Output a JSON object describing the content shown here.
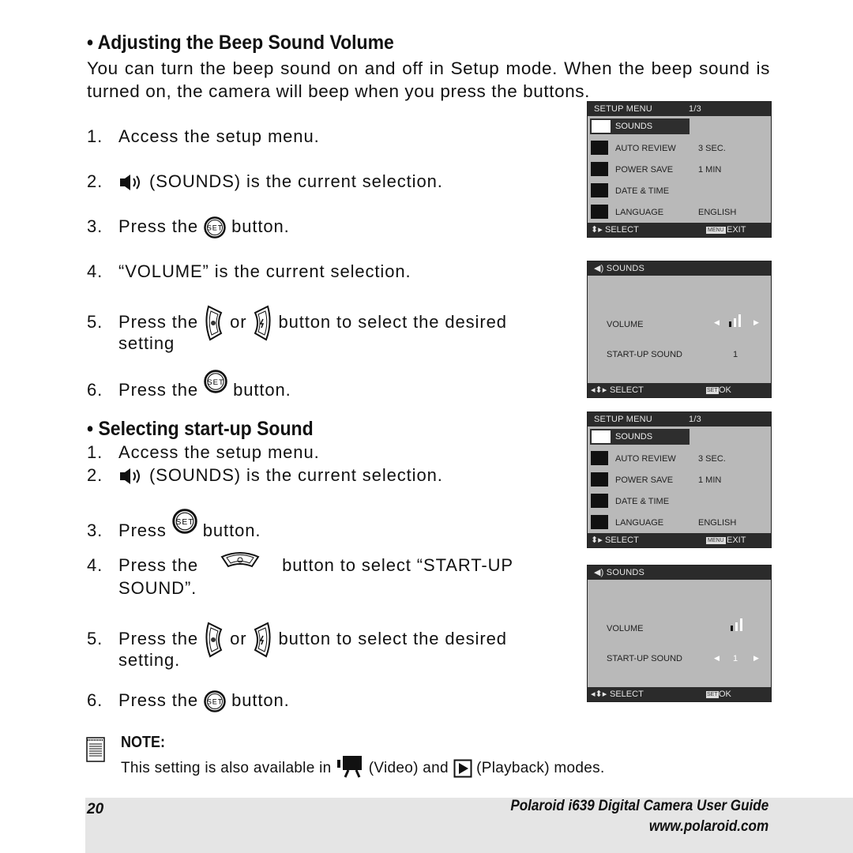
{
  "section1": {
    "heading": "• Adjusting the Beep Sound Volume",
    "intro": "You can turn the beep sound on and off in Setup mode. When the beep sound is turned on, the camera will beep when you press the buttons.",
    "steps": [
      {
        "num": "1.",
        "text": "Access the setup menu."
      },
      {
        "num": "2.",
        "icon": "speaker-icon",
        "text": "(SOUNDS) is the current selection."
      },
      {
        "num": "3.",
        "pre": "Press the",
        "icon": "set-button-icon",
        "post": "button."
      },
      {
        "num": "4.",
        "text": "“VOLUME” is the current selection."
      },
      {
        "num": "5.",
        "pre": "Press the",
        "mid": "or",
        "post": "button to select the desired",
        "cont": "setting"
      },
      {
        "num": "6.",
        "pre": "Press the",
        "icon": "set-button-icon",
        "post": "button."
      }
    ]
  },
  "section2": {
    "heading": "• Selecting start-up Sound",
    "steps": [
      {
        "num": "1.",
        "text": "Access the setup menu."
      },
      {
        "num": "2.",
        "icon": "speaker-icon",
        "text": "(SOUNDS) is the current selection."
      },
      {
        "num": "3.",
        "pre": "Press",
        "icon": "set-button-icon",
        "post": "button."
      },
      {
        "num": "4.",
        "pre": "Press the",
        "post": "button to select “START-UP",
        "cont": "SOUND”."
      },
      {
        "num": "5.",
        "pre": "Press the",
        "mid": "or",
        "post": "button to select the desired",
        "cont": "setting."
      },
      {
        "num": "6.",
        "pre": "Press the",
        "icon": "set-button-icon",
        "post": "button."
      }
    ]
  },
  "screens": {
    "setup_menu": {
      "title": "SETUP MENU",
      "page": "1/3",
      "items": [
        {
          "icon": "speaker-icon",
          "label": "SOUNDS",
          "value": ""
        },
        {
          "icon": "auto-review-icon",
          "label": "AUTO REVIEW",
          "value": "3 SEC."
        },
        {
          "icon": "power-save-icon",
          "label": "POWER SAVE",
          "value": "1 MIN"
        },
        {
          "icon": "date-time-icon",
          "label": "DATE & TIME",
          "value": ""
        },
        {
          "icon": "language-icon",
          "label": "LANGUAGE",
          "value": "ENGLISH"
        }
      ],
      "footer_left": "SELECT",
      "footer_right_badge": "MENU",
      "footer_right": "EXIT"
    },
    "sounds_menu": {
      "title": "SOUNDS",
      "volume_label": "VOLUME",
      "startup_label": "START-UP SOUND",
      "startup_value": "1",
      "volume_level": "1 of 3 bars",
      "footer_left": "SELECT",
      "footer_right_badge": "SET",
      "footer_right": "OK"
    }
  },
  "note": {
    "title": "NOTE:",
    "pre": "This setting is also available in",
    "video": "(Video) and",
    "playback": "(Playback) modes."
  },
  "footer": {
    "page_number": "20",
    "guide_title": "Polaroid i639 Digital Camera User Guide",
    "url": "www.polaroid.com"
  }
}
